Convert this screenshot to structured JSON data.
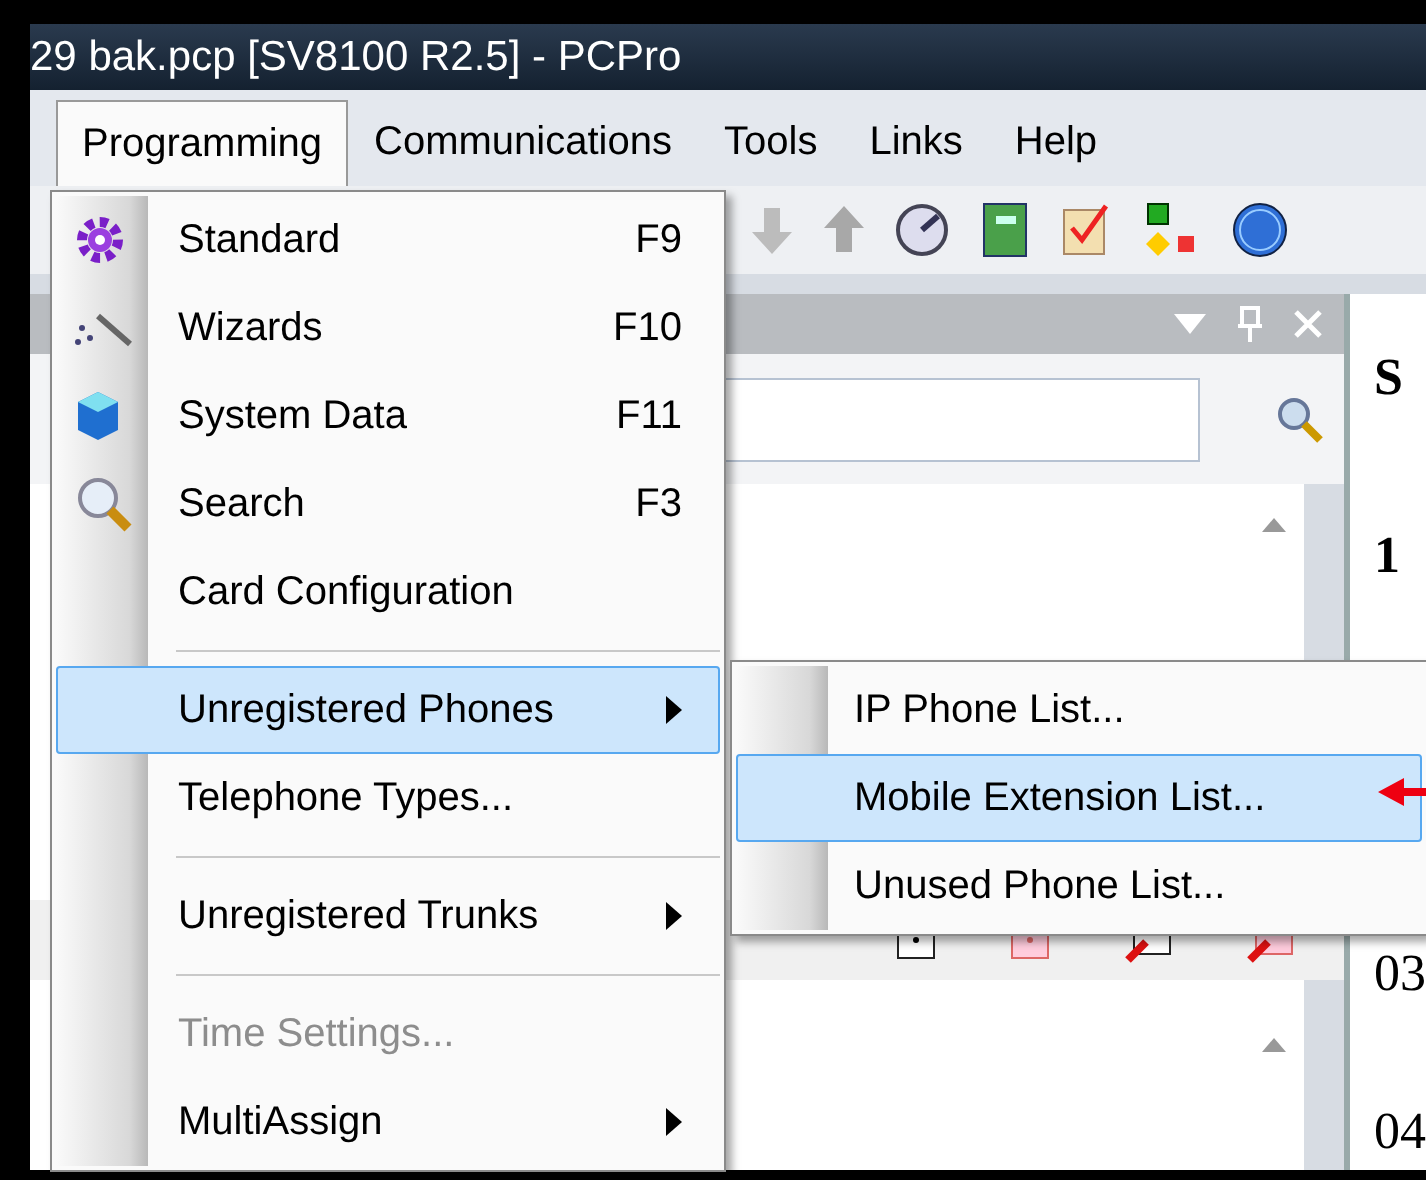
{
  "window": {
    "title": "29 bak.pcp [SV8100 R2.5] - PCPro"
  },
  "menu_bar": [
    {
      "label": "Programming",
      "selected": true
    },
    {
      "label": "Communications",
      "selected": false
    },
    {
      "label": "Tools",
      "selected": false
    },
    {
      "label": "Links",
      "selected": false
    },
    {
      "label": "Help",
      "selected": false
    }
  ],
  "programming_menu": [
    {
      "kind": "item",
      "label": "Standard",
      "shortcut": "F9",
      "selected": false,
      "disabled": false
    },
    {
      "kind": "item",
      "label": "Wizards",
      "shortcut": "F10",
      "selected": false,
      "disabled": false
    },
    {
      "kind": "item",
      "label": "System Data",
      "shortcut": "F11",
      "selected": false,
      "disabled": false
    },
    {
      "kind": "item",
      "label": "Search",
      "shortcut": "F3",
      "selected": false,
      "disabled": false
    },
    {
      "kind": "item",
      "label": "Card Configuration",
      "selected": false,
      "disabled": false
    },
    {
      "kind": "separator"
    },
    {
      "kind": "submenu",
      "label": "Unregistered Phones",
      "selected": true,
      "disabled": false
    },
    {
      "kind": "item",
      "label": "Telephone Types...",
      "selected": false,
      "disabled": false
    },
    {
      "kind": "separator"
    },
    {
      "kind": "submenu",
      "label": "Unregistered Trunks",
      "selected": false,
      "disabled": false
    },
    {
      "kind": "separator"
    },
    {
      "kind": "item",
      "label": "Time Settings...",
      "selected": false,
      "disabled": true
    },
    {
      "kind": "submenu",
      "label": "MultiAssign",
      "selected": false,
      "disabled": false
    }
  ],
  "submenu": [
    {
      "label": "IP Phone List...",
      "selected": false
    },
    {
      "label": "Mobile Extension List...",
      "selected": true
    },
    {
      "label": "Unused Phone List...",
      "selected": false
    }
  ],
  "right_pane": [
    "S",
    "1",
    "03",
    "04"
  ]
}
